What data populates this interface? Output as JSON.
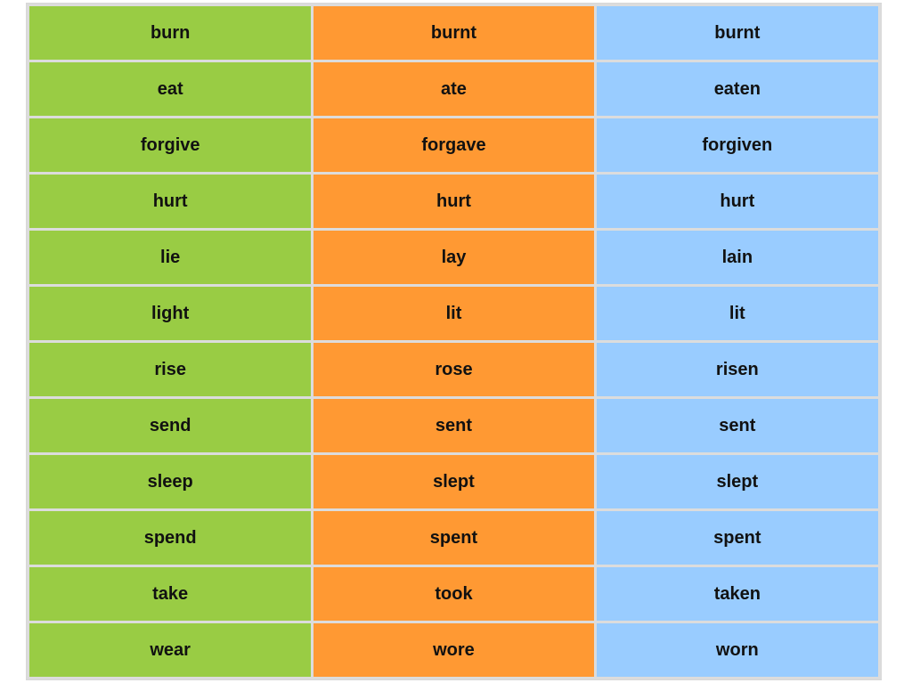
{
  "colors": {
    "base": "#99cc44",
    "past": "#ff9933",
    "participle": "#99ccff",
    "grid": "#dcdcdc"
  },
  "rows": [
    [
      "burn",
      "burnt",
      "burnt"
    ],
    [
      "eat",
      "ate",
      "eaten"
    ],
    [
      "forgive",
      "forgave",
      "forgiven"
    ],
    [
      "hurt",
      "hurt",
      "hurt"
    ],
    [
      "lie",
      "lay",
      "lain"
    ],
    [
      "light",
      "lit",
      "lit"
    ],
    [
      "rise",
      "rose",
      "risen"
    ],
    [
      "send",
      "sent",
      "sent"
    ],
    [
      "sleep",
      "slept",
      "slept"
    ],
    [
      "spend",
      "spent",
      "spent"
    ],
    [
      "take",
      "took",
      "taken"
    ],
    [
      "wear",
      "wore",
      "worn"
    ]
  ]
}
